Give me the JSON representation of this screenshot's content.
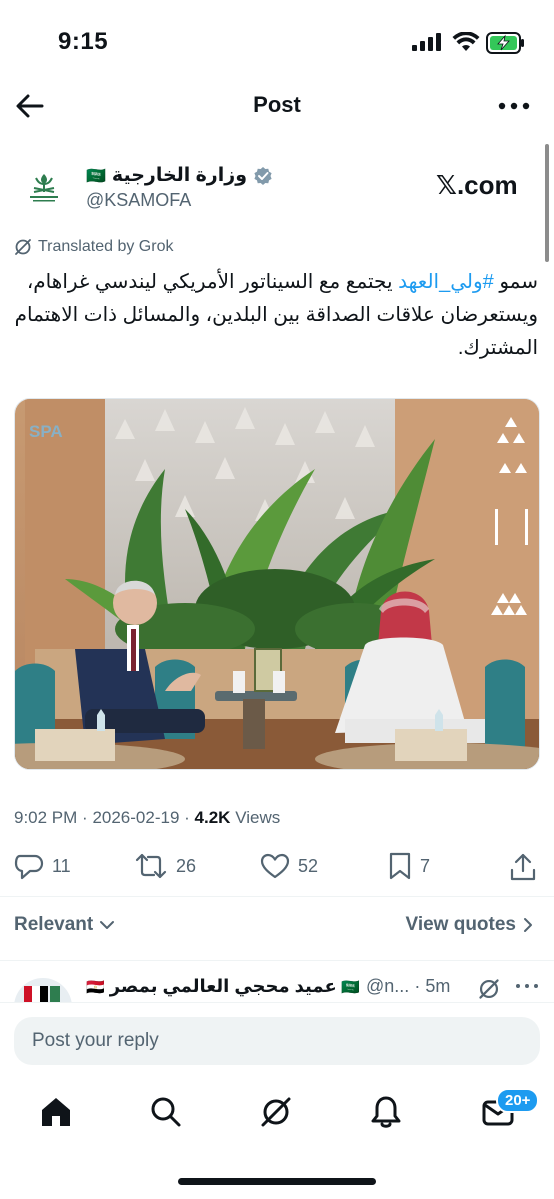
{
  "status_bar": {
    "time": "9:15"
  },
  "header": {
    "title": "Post"
  },
  "author": {
    "name": "وزارة الخارجية",
    "flag": "🇸🇦",
    "handle": "@KSAMOFA",
    "site": "𝕏.com"
  },
  "translation_note": "Translated by Grok",
  "tweet": {
    "prefix": "سمو ",
    "hashtag": "#ولي_العهد",
    "body": " يجتمع مع السيناتور الأمريكي ليندسي غراهام، ويستعرضان علاقات الصداقة بين البلدين، والمسائل ذات الاهتمام المشترك."
  },
  "media": {
    "watermark": "SPA"
  },
  "meta": {
    "time": "9:02 PM",
    "date": "2026-02-19",
    "views_count": "4.2K",
    "views_label": "Views"
  },
  "actions": {
    "replies": "11",
    "reposts": "26",
    "likes": "52",
    "bookmarks": "7"
  },
  "sort": {
    "relevant_label": "Relevant",
    "quotes_label": "View quotes"
  },
  "reply_preview": {
    "name": "عميد محجي العالمي بمصر",
    "handle": "@n...",
    "time": "5m"
  },
  "composer": {
    "placeholder": "Post your reply"
  },
  "tabbar": {
    "messages_badge": "20+"
  },
  "colors": {
    "accent": "#1d9bf0",
    "muted": "#536471",
    "text": "#0f1419"
  }
}
